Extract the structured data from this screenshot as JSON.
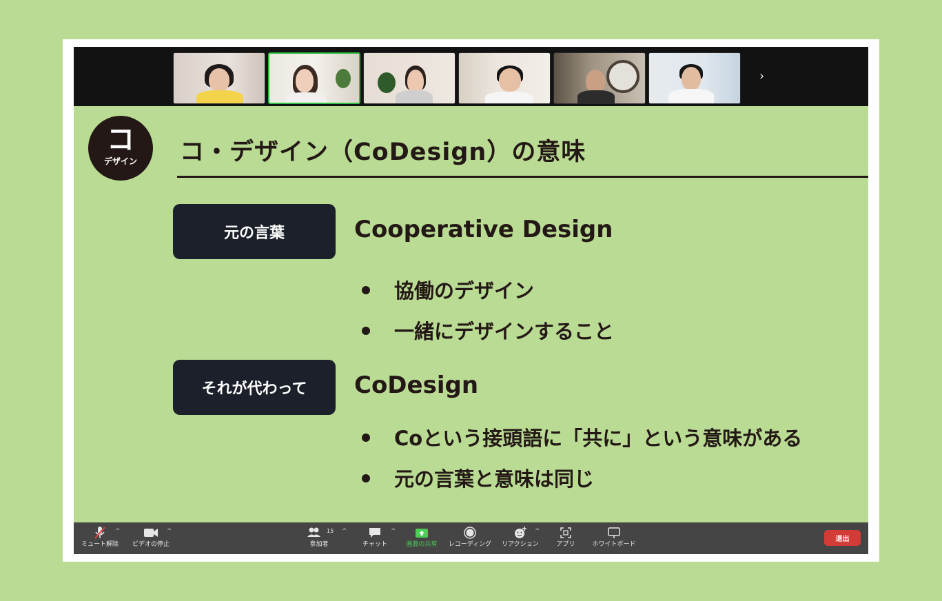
{
  "window": {
    "participants_more_arrow": "›",
    "participants": [
      {
        "name": "participant-1",
        "active": false
      },
      {
        "name": "participant-2",
        "active": true
      },
      {
        "name": "participant-3",
        "active": false
      },
      {
        "name": "participant-4",
        "active": false
      },
      {
        "name": "participant-5",
        "active": false
      },
      {
        "name": "participant-6",
        "active": false
      }
    ]
  },
  "slide": {
    "badge_big": "コ",
    "badge_small": "デザイン",
    "title": "コ・デザイン（CoDesign）の意味",
    "section1": {
      "label": "元の言葉",
      "heading": "Cooperative Design",
      "bullets": [
        "協働のデザイン",
        "一緒にデザインすること"
      ]
    },
    "section2": {
      "label": "それが代わって",
      "heading": "CoDesign",
      "bullets": [
        "Coという接頭語に「共に」という意味がある",
        "元の言葉と意味は同じ"
      ]
    },
    "colors": {
      "background": "#badb94",
      "text": "#231815",
      "label_box": "#1b202a"
    }
  },
  "toolbar": {
    "mute_label": "ミュート解除",
    "video_label": "ビデオの停止",
    "participants_label": "参加者",
    "participants_count": "15",
    "chat_label": "チャット",
    "share_label": "画面の共有",
    "record_label": "レコーディング",
    "reaction_label": "リアクション",
    "apps_label": "アプリ",
    "whiteboard_label": "ホワイトボード",
    "leave_label": "退出",
    "share_color": "#4ccd57",
    "leave_color": "#d23b36"
  }
}
